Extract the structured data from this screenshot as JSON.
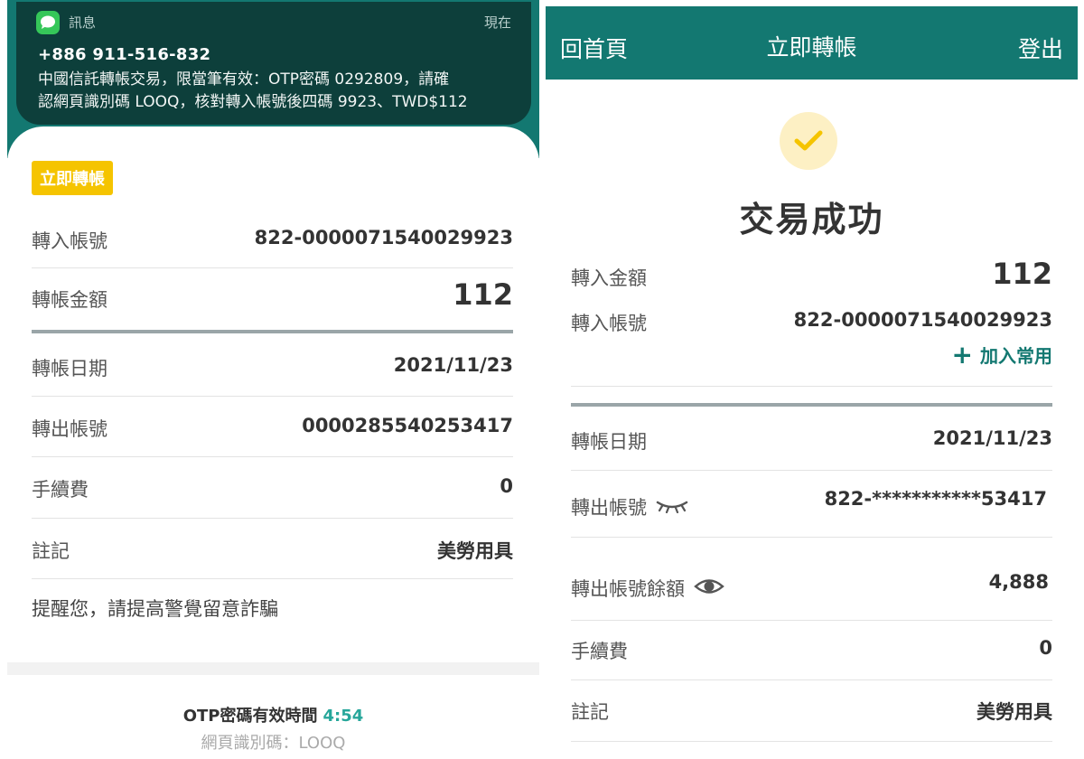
{
  "notification": {
    "app_name": "訊息",
    "time": "現在",
    "sender": "+886 911-516-832",
    "line1": "中國信託轉帳交易，限當筆有效：OTP密碼 0292809，請確",
    "line2": "認網頁識別碼 LOOQ，核對轉入帳號後四碼 9923、TWD$112"
  },
  "left": {
    "badge": "立即轉帳",
    "rows": [
      {
        "label": "轉入帳號",
        "value": "822-0000071540029923"
      },
      {
        "label": "轉帳金額",
        "value": "112"
      },
      {
        "label": "轉帳日期",
        "value": "2021/11/23"
      },
      {
        "label": "轉出帳號",
        "value": "0000285540253417"
      },
      {
        "label": "手續費",
        "value": "0"
      },
      {
        "label": "註記",
        "value": "美勞用具"
      }
    ],
    "reminder": "提醒您，請提高警覺留意詐騙",
    "otp_label": "OTP密碼有效時間",
    "otp_countdown": "4:54",
    "web_code": "網頁識別碼：LOOQ"
  },
  "right": {
    "topbar": {
      "home": "回首頁",
      "title": "立即轉帳",
      "logout": "登出"
    },
    "status": "交易成功",
    "rows": [
      {
        "label": "轉入金額",
        "value": "112"
      },
      {
        "label": "轉入帳號",
        "value": "822-0000071540029923"
      },
      {
        "label": "轉帳日期",
        "value": "2021/11/23"
      },
      {
        "label": "轉出帳號",
        "value": "822-***********53417"
      },
      {
        "label": "轉出帳號餘額",
        "value": "4,888"
      },
      {
        "label": "手續費",
        "value": "0"
      },
      {
        "label": "註記",
        "value": "美勞用具"
      }
    ],
    "add_favorite": "加入常用"
  },
  "colors": {
    "teal": "#137871",
    "badge_yellow": "#f5c400",
    "check_yellow": "#f5c400",
    "countdown_green": "#26a69a"
  }
}
